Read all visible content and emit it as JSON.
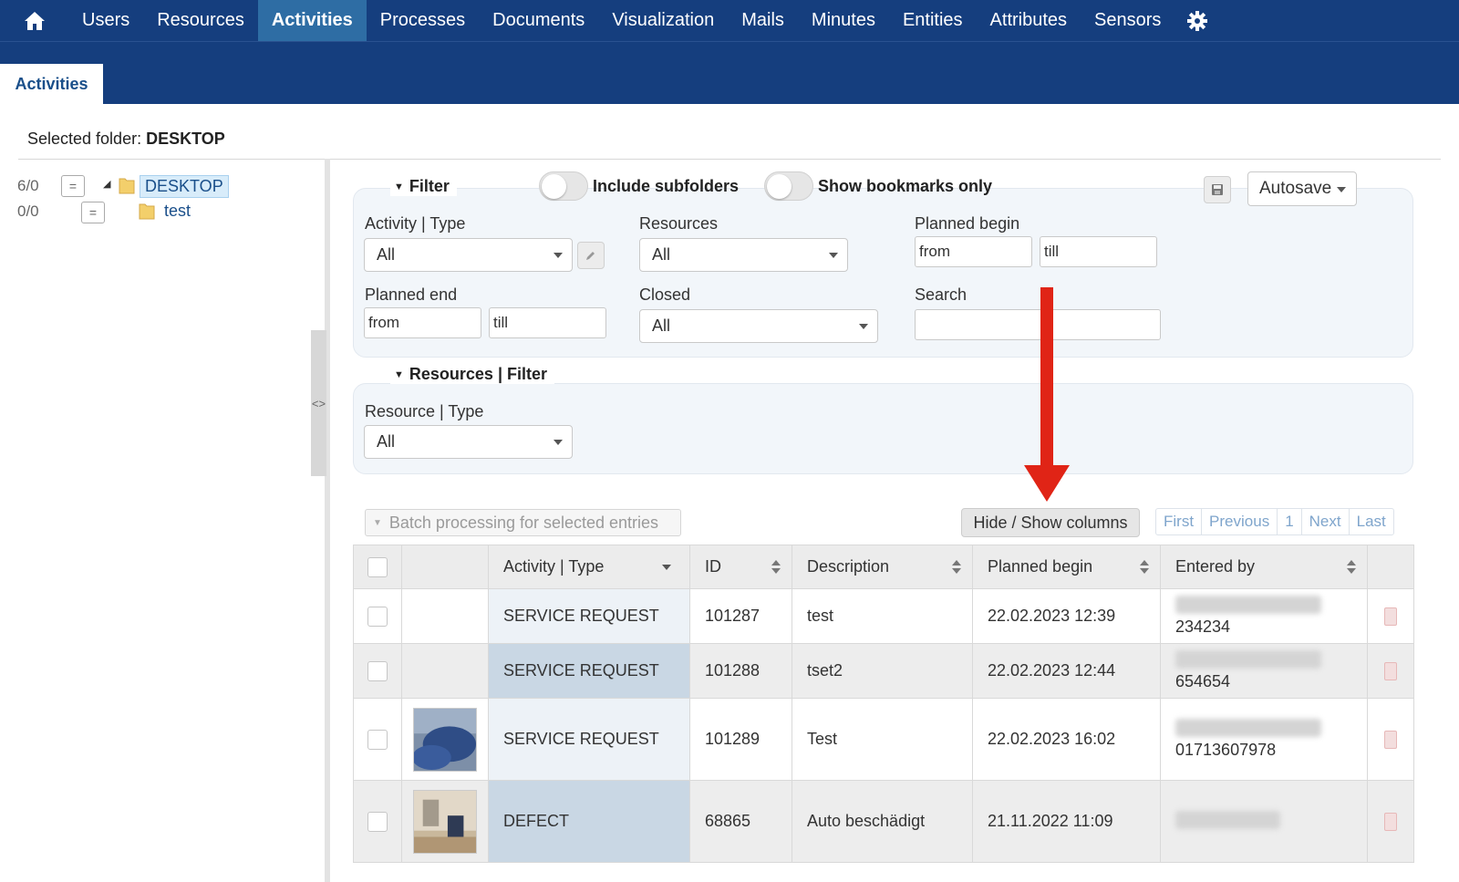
{
  "nav": {
    "items": [
      "Users",
      "Resources",
      "Activities",
      "Processes",
      "Documents",
      "Visualization",
      "Mails",
      "Minutes",
      "Entities",
      "Attributes",
      "Sensors"
    ],
    "active": "Activities"
  },
  "tab": {
    "label": "Activities"
  },
  "selected_folder": {
    "label": "Selected folder:",
    "value": "DESKTOP"
  },
  "tree": [
    {
      "count": "6/0",
      "label": "DESKTOP"
    },
    {
      "count": "0/0",
      "label": "test"
    }
  ],
  "filter": {
    "title": "Filter",
    "include_subfolders": "Include subfolders",
    "show_bookmarks_only": "Show bookmarks only",
    "autosave": "Autosave",
    "activity_type": {
      "label": "Activity | Type",
      "value": "All"
    },
    "resources": {
      "label": "Resources",
      "value": "All"
    },
    "planned_begin": {
      "label": "Planned begin",
      "from": "from",
      "till": "till"
    },
    "planned_end": {
      "label": "Planned end",
      "from": "from",
      "till": "till"
    },
    "closed": {
      "label": "Closed",
      "value": "All"
    },
    "search": {
      "label": "Search",
      "value": ""
    }
  },
  "resources_filter": {
    "title": "Resources | Filter",
    "resource_type": {
      "label": "Resource | Type",
      "value": "All"
    }
  },
  "toolbar": {
    "batch": "Batch processing for selected entries",
    "hide_show": "Hide / Show columns",
    "pager": [
      "First",
      "Previous",
      "1",
      "Next",
      "Last"
    ]
  },
  "table": {
    "columns": [
      "Activity | Type",
      "ID",
      "Description",
      "Planned begin",
      "Entered by"
    ],
    "rows": [
      {
        "type": "SERVICE REQUEST",
        "id": "101287",
        "description": "test",
        "planned_begin": "22.02.2023 12:39",
        "entered_by": "234234"
      },
      {
        "type": "SERVICE REQUEST",
        "id": "101288",
        "description": "tset2",
        "planned_begin": "22.02.2023 12:44",
        "entered_by": "654654"
      },
      {
        "type": "SERVICE REQUEST",
        "id": "101289",
        "description": "Test",
        "planned_begin": "22.02.2023 16:02",
        "entered_by": "01713607978"
      },
      {
        "type": "DEFECT",
        "id": "68865",
        "description": "Auto beschädigt",
        "planned_begin": "21.11.2022 11:09",
        "entered_by": ""
      }
    ]
  },
  "colors": {
    "nav_bg": "#153e7e",
    "nav_active": "#2e6da4",
    "arrow": "#e02416"
  }
}
